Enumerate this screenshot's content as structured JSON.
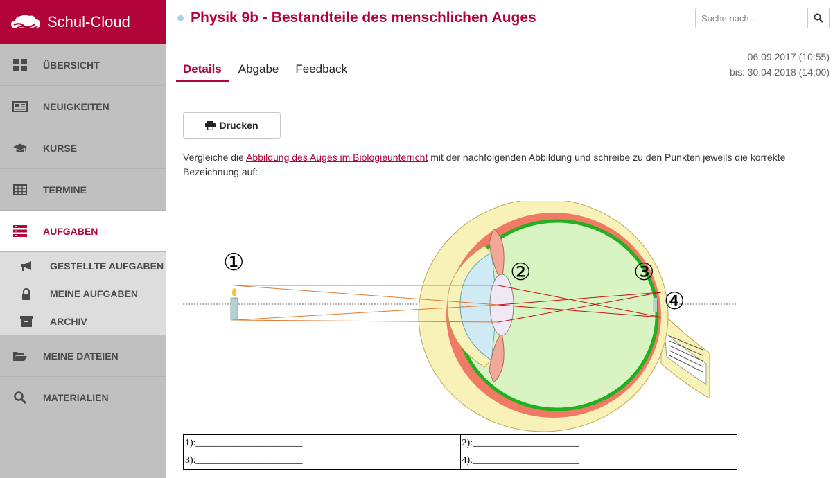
{
  "app": {
    "name": "Schul-Cloud"
  },
  "colors": {
    "brand": "#b10438",
    "sidebar": "#c0c0c0",
    "active_bg": "#ffffff",
    "subnav_bg": "#dddddd",
    "status_dot": "#a9d0ea"
  },
  "sidebar": {
    "items": [
      {
        "label": "ÜBERSICHT",
        "icon": "dashboard-icon"
      },
      {
        "label": "NEUIGKEITEN",
        "icon": "newspaper-icon"
      },
      {
        "label": "KURSE",
        "icon": "graduation-cap-icon"
      },
      {
        "label": "TERMINE",
        "icon": "calendar-table-icon"
      },
      {
        "label": "AUFGABEN",
        "icon": "tasks-icon",
        "active": true
      },
      {
        "label": "MEINE DATEIEN",
        "icon": "folder-open-icon"
      },
      {
        "label": "MATERIALIEN",
        "icon": "search-icon"
      }
    ],
    "subitems": [
      {
        "label": "GESTELLTE AUFGABEN",
        "icon": "bullhorn-icon"
      },
      {
        "label": "MEINE AUFGABEN",
        "icon": "lock-icon"
      },
      {
        "label": "ARCHIV",
        "icon": "archive-icon"
      }
    ]
  },
  "header": {
    "title": "Physik 9b - Bestandteile des menschlichen Auges"
  },
  "search": {
    "placeholder": "Suche nach..."
  },
  "tabs": [
    {
      "label": "Details",
      "active": true
    },
    {
      "label": "Abgabe"
    },
    {
      "label": "Feedback"
    }
  ],
  "dates": {
    "start": "06.09.2017 (10:55)",
    "due": "bis: 30.04.2018 (14:00)"
  },
  "print_button": {
    "label": "Drucken"
  },
  "description": {
    "before": "Vergleiche die ",
    "link": "Abbildung des Auges im Biologieunterricht",
    "after": " mit der nachfolgenden Abbildung und schreibe zu den Punkten jeweils die korrekte Bezeichnung auf:"
  },
  "figure": {
    "markers": [
      "①",
      "②",
      "③",
      "④"
    ]
  },
  "answers": [
    [
      "1):______________________",
      "2):______________________"
    ],
    [
      "3):______________________",
      "4):______________________"
    ]
  ]
}
